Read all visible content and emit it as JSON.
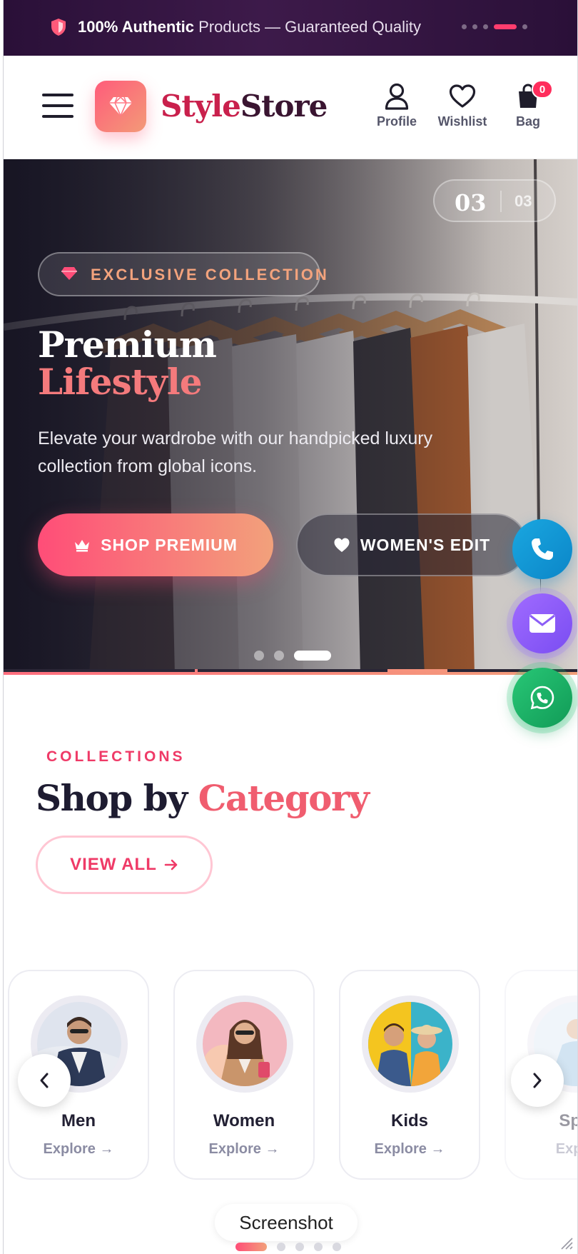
{
  "announcement": {
    "strong": "100% Authentic",
    "rest": " Products — Guaranteed Quality",
    "slide_count": 5,
    "active_slide": 4
  },
  "header": {
    "brand_part1": "Style",
    "brand_part2": "Store",
    "profile_label": "Profile",
    "wishlist_label": "Wishlist",
    "bag_label": "Bag",
    "bag_count": "0"
  },
  "hero": {
    "counter_current": "03",
    "counter_total": "03",
    "badge": "EXCLUSIVE COLLECTION",
    "title_line1": "Premium",
    "title_line2": "Lifestyle",
    "subtitle": "Elevate your wardrobe with our handpicked luxury collection from global icons.",
    "primary_cta": "SHOP PREMIUM",
    "secondary_cta": "WOMEN'S EDIT",
    "slides": 3,
    "active_slide": 3
  },
  "collections": {
    "eyebrow": "COLLECTIONS",
    "title_dark": "Shop by ",
    "title_accent": "Category",
    "view_all": "VIEW ALL",
    "categories": [
      {
        "name": "Men",
        "explore": "Explore →"
      },
      {
        "name": "Women",
        "explore": "Explore →"
      },
      {
        "name": "Kids",
        "explore": "Explore →"
      },
      {
        "name": "Spo",
        "explore": "Explo"
      }
    ]
  },
  "footer": {
    "screenshot_label": "Screenshot"
  },
  "colors": {
    "accent_pink": "#ef3a67",
    "accent_peach": "#f2a17b",
    "announce_bg": "#2a1038",
    "call": "#0b86c8",
    "mail": "#7a4df2",
    "whatsapp": "#119b57"
  },
  "icons": [
    "shield-icon",
    "menu-icon",
    "diamond-icon",
    "user-icon",
    "heart-icon",
    "bag-icon",
    "crown-icon",
    "arrow-right-icon",
    "chevron-left-icon",
    "chevron-right-icon",
    "phone-icon",
    "mail-icon",
    "whatsapp-icon"
  ]
}
